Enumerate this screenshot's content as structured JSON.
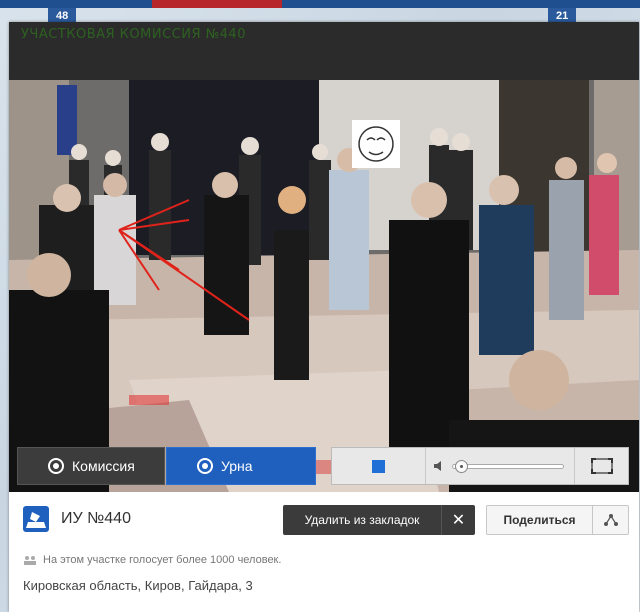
{
  "map": {
    "badge_left": "48",
    "badge_right": "21"
  },
  "video": {
    "overlay_text": "УЧАСТКОВАЯ КОМИССИЯ №440"
  },
  "controls": {
    "commission_label": "Комиссия",
    "urn_label": "Урна"
  },
  "station": {
    "title": "ИУ №440",
    "remove_bookmark_label": "Удалить из закладок",
    "share_label": "Поделиться",
    "voters_note": "На этом участке голосует более 1000 человек.",
    "address": "Кировская область, Киров, Гайдара, 3"
  },
  "colors": {
    "accent": "#1f5fbd",
    "dark_button": "#3b3b3b",
    "annotation_red": "#e0231a"
  }
}
